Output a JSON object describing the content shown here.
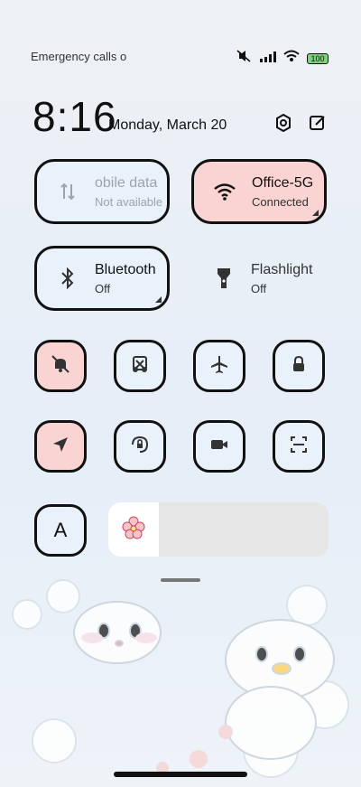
{
  "status_bar": {
    "left_text": "Emergency calls o",
    "battery": "100"
  },
  "clock": {
    "time": "8:16",
    "date": "Monday, March 20"
  },
  "tiles": {
    "mobile": {
      "title": "obile data",
      "subtitle": "Not available"
    },
    "wifi": {
      "title": "Office-5G",
      "subtitle": "Connected"
    },
    "bluetooth": {
      "title": "Bluetooth",
      "subtitle": "Off"
    },
    "flashlight": {
      "title": "Flashlight",
      "subtitle": "Off"
    }
  },
  "font_tile": {
    "label": "A"
  },
  "icons": {
    "settings": "gear-icon",
    "edit": "edit-icon"
  },
  "colors": {
    "accent_pink": "#f9d4d2",
    "tile_bg": "#e9f2fb"
  }
}
